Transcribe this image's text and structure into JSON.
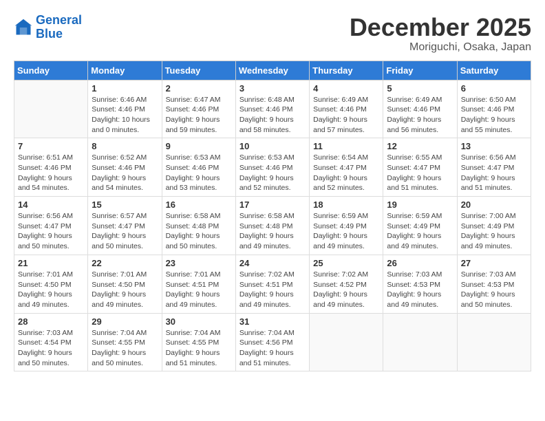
{
  "header": {
    "logo_line1": "General",
    "logo_line2": "Blue",
    "month": "December 2025",
    "location": "Moriguchi, Osaka, Japan"
  },
  "weekdays": [
    "Sunday",
    "Monday",
    "Tuesday",
    "Wednesday",
    "Thursday",
    "Friday",
    "Saturday"
  ],
  "weeks": [
    [
      {
        "day": "",
        "info": ""
      },
      {
        "day": "1",
        "info": "Sunrise: 6:46 AM\nSunset: 4:46 PM\nDaylight: 10 hours\nand 0 minutes."
      },
      {
        "day": "2",
        "info": "Sunrise: 6:47 AM\nSunset: 4:46 PM\nDaylight: 9 hours\nand 59 minutes."
      },
      {
        "day": "3",
        "info": "Sunrise: 6:48 AM\nSunset: 4:46 PM\nDaylight: 9 hours\nand 58 minutes."
      },
      {
        "day": "4",
        "info": "Sunrise: 6:49 AM\nSunset: 4:46 PM\nDaylight: 9 hours\nand 57 minutes."
      },
      {
        "day": "5",
        "info": "Sunrise: 6:49 AM\nSunset: 4:46 PM\nDaylight: 9 hours\nand 56 minutes."
      },
      {
        "day": "6",
        "info": "Sunrise: 6:50 AM\nSunset: 4:46 PM\nDaylight: 9 hours\nand 55 minutes."
      }
    ],
    [
      {
        "day": "7",
        "info": "Sunrise: 6:51 AM\nSunset: 4:46 PM\nDaylight: 9 hours\nand 54 minutes."
      },
      {
        "day": "8",
        "info": "Sunrise: 6:52 AM\nSunset: 4:46 PM\nDaylight: 9 hours\nand 54 minutes."
      },
      {
        "day": "9",
        "info": "Sunrise: 6:53 AM\nSunset: 4:46 PM\nDaylight: 9 hours\nand 53 minutes."
      },
      {
        "day": "10",
        "info": "Sunrise: 6:53 AM\nSunset: 4:46 PM\nDaylight: 9 hours\nand 52 minutes."
      },
      {
        "day": "11",
        "info": "Sunrise: 6:54 AM\nSunset: 4:47 PM\nDaylight: 9 hours\nand 52 minutes."
      },
      {
        "day": "12",
        "info": "Sunrise: 6:55 AM\nSunset: 4:47 PM\nDaylight: 9 hours\nand 51 minutes."
      },
      {
        "day": "13",
        "info": "Sunrise: 6:56 AM\nSunset: 4:47 PM\nDaylight: 9 hours\nand 51 minutes."
      }
    ],
    [
      {
        "day": "14",
        "info": "Sunrise: 6:56 AM\nSunset: 4:47 PM\nDaylight: 9 hours\nand 50 minutes."
      },
      {
        "day": "15",
        "info": "Sunrise: 6:57 AM\nSunset: 4:47 PM\nDaylight: 9 hours\nand 50 minutes."
      },
      {
        "day": "16",
        "info": "Sunrise: 6:58 AM\nSunset: 4:48 PM\nDaylight: 9 hours\nand 50 minutes."
      },
      {
        "day": "17",
        "info": "Sunrise: 6:58 AM\nSunset: 4:48 PM\nDaylight: 9 hours\nand 49 minutes."
      },
      {
        "day": "18",
        "info": "Sunrise: 6:59 AM\nSunset: 4:49 PM\nDaylight: 9 hours\nand 49 minutes."
      },
      {
        "day": "19",
        "info": "Sunrise: 6:59 AM\nSunset: 4:49 PM\nDaylight: 9 hours\nand 49 minutes."
      },
      {
        "day": "20",
        "info": "Sunrise: 7:00 AM\nSunset: 4:49 PM\nDaylight: 9 hours\nand 49 minutes."
      }
    ],
    [
      {
        "day": "21",
        "info": "Sunrise: 7:01 AM\nSunset: 4:50 PM\nDaylight: 9 hours\nand 49 minutes."
      },
      {
        "day": "22",
        "info": "Sunrise: 7:01 AM\nSunset: 4:50 PM\nDaylight: 9 hours\nand 49 minutes."
      },
      {
        "day": "23",
        "info": "Sunrise: 7:01 AM\nSunset: 4:51 PM\nDaylight: 9 hours\nand 49 minutes."
      },
      {
        "day": "24",
        "info": "Sunrise: 7:02 AM\nSunset: 4:51 PM\nDaylight: 9 hours\nand 49 minutes."
      },
      {
        "day": "25",
        "info": "Sunrise: 7:02 AM\nSunset: 4:52 PM\nDaylight: 9 hours\nand 49 minutes."
      },
      {
        "day": "26",
        "info": "Sunrise: 7:03 AM\nSunset: 4:53 PM\nDaylight: 9 hours\nand 49 minutes."
      },
      {
        "day": "27",
        "info": "Sunrise: 7:03 AM\nSunset: 4:53 PM\nDaylight: 9 hours\nand 50 minutes."
      }
    ],
    [
      {
        "day": "28",
        "info": "Sunrise: 7:03 AM\nSunset: 4:54 PM\nDaylight: 9 hours\nand 50 minutes."
      },
      {
        "day": "29",
        "info": "Sunrise: 7:04 AM\nSunset: 4:55 PM\nDaylight: 9 hours\nand 50 minutes."
      },
      {
        "day": "30",
        "info": "Sunrise: 7:04 AM\nSunset: 4:55 PM\nDaylight: 9 hours\nand 51 minutes."
      },
      {
        "day": "31",
        "info": "Sunrise: 7:04 AM\nSunset: 4:56 PM\nDaylight: 9 hours\nand 51 minutes."
      },
      {
        "day": "",
        "info": ""
      },
      {
        "day": "",
        "info": ""
      },
      {
        "day": "",
        "info": ""
      }
    ]
  ]
}
